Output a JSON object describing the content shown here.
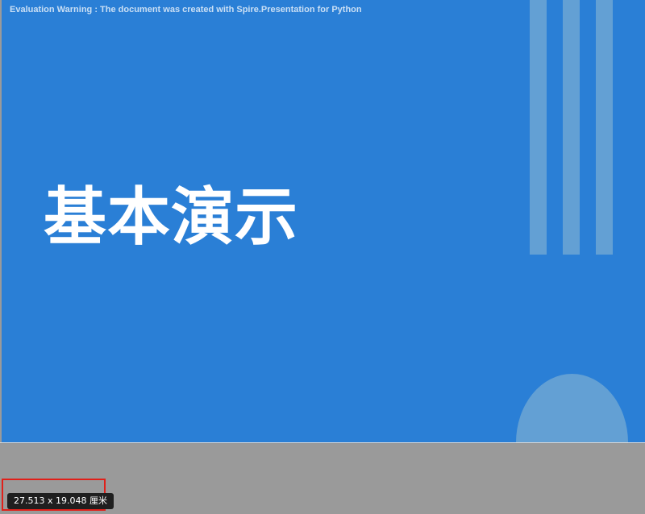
{
  "slide": {
    "warning_text": "Evaluation Warning : The document was created with Spire.Presentation for Python",
    "title": "基本演示",
    "background_color": "#2a7fd6",
    "accent_color": "#63a0d4"
  },
  "status": {
    "slide_size": "27.513 x 19.048 厘米",
    "highlight_color": "#e0201a"
  }
}
